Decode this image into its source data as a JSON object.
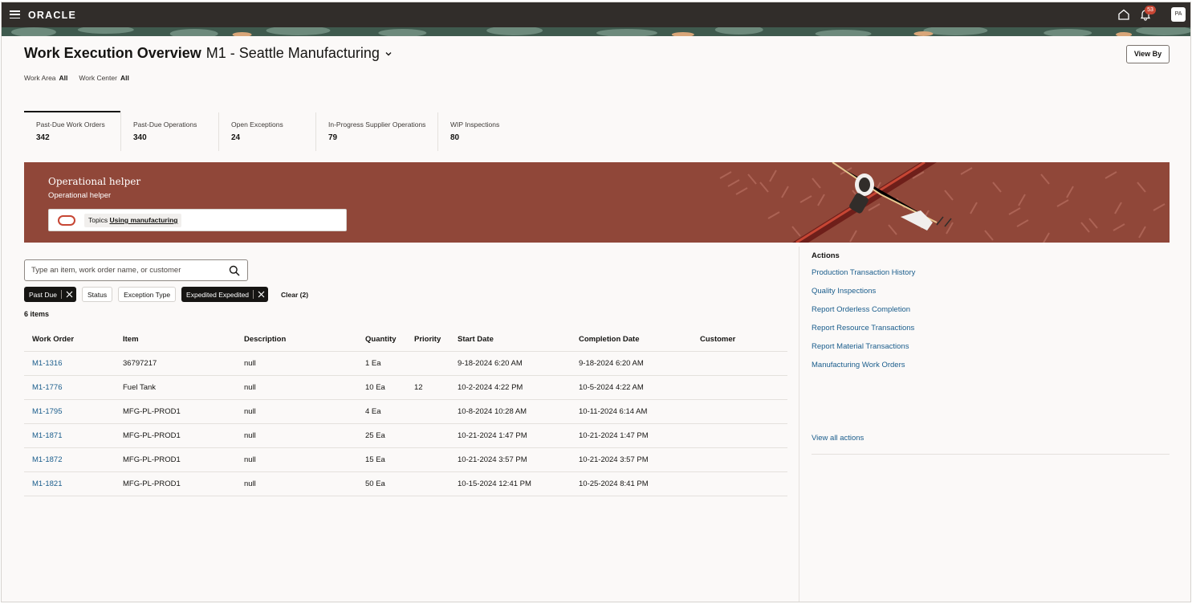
{
  "header": {
    "logo": "ORACLE",
    "notification_count": "53",
    "avatar_initials": "PA"
  },
  "page": {
    "title": "Work Execution Overview",
    "subtitle": "M1 - Seattle Manufacturing",
    "view_by_label": "View By",
    "filters": [
      {
        "label": "Work Area",
        "value": "All"
      },
      {
        "label": "Work Center",
        "value": "All"
      }
    ]
  },
  "metrics": [
    {
      "label": "Past-Due Work Orders",
      "value": "342"
    },
    {
      "label": "Past-Due Operations",
      "value": "340"
    },
    {
      "label": "Open Exceptions",
      "value": "24"
    },
    {
      "label": "In-Progress Supplier Operations",
      "value": "79"
    },
    {
      "label": "WIP Inspections",
      "value": "80"
    }
  ],
  "helper": {
    "title": "Operational helper",
    "subtitle": "Operational helper",
    "topics_label": "Topics",
    "topics_link": "Using manufacturing"
  },
  "search": {
    "placeholder": "Type an item, work order name, or customer"
  },
  "chips": {
    "past_due": "Past Due",
    "status": "Status",
    "exception_type": "Exception Type",
    "expedited": "Expedited Expedited",
    "clear": "Clear (2)"
  },
  "table": {
    "count_label": "6 items",
    "columns": [
      "Work Order",
      "Item",
      "Description",
      "Quantity",
      "Priority",
      "Start Date",
      "Completion Date",
      "Customer"
    ],
    "rows": [
      [
        "M1-1316",
        "36797217",
        "null",
        "1 Ea",
        "",
        "9-18-2024 6:20 AM",
        "9-18-2024 6:20 AM",
        ""
      ],
      [
        "M1-1776",
        "Fuel Tank",
        "null",
        "10 Ea",
        "12",
        "10-2-2024 4:22 PM",
        "10-5-2024 4:22 AM",
        ""
      ],
      [
        "M1-1795",
        "MFG-PL-PROD1",
        "null",
        "4 Ea",
        "",
        "10-8-2024 10:28 AM",
        "10-11-2024 6:14 AM",
        ""
      ],
      [
        "M1-1871",
        "MFG-PL-PROD1",
        "null",
        "25 Ea",
        "",
        "10-21-2024 1:47 PM",
        "10-21-2024 1:47 PM",
        ""
      ],
      [
        "M1-1872",
        "MFG-PL-PROD1",
        "null",
        "15 Ea",
        "",
        "10-21-2024 3:57 PM",
        "10-21-2024 3:57 PM",
        ""
      ],
      [
        "M1-1821",
        "MFG-PL-PROD1",
        "null",
        "50 Ea",
        "",
        "10-15-2024 12:41 PM",
        "10-25-2024 8:41 PM",
        ""
      ]
    ]
  },
  "actions": {
    "title": "Actions",
    "items": [
      "Production Transaction History",
      "Quality Inspections",
      "Report Orderless Completion",
      "Report Resource Transactions",
      "Report Material Transactions",
      "Manufacturing Work Orders"
    ],
    "view_all": "View all actions"
  },
  "colors": {
    "topbar": "#312d2a",
    "helper_banner": "#904739",
    "link": "#1a5d8c",
    "badge": "#c74634"
  }
}
